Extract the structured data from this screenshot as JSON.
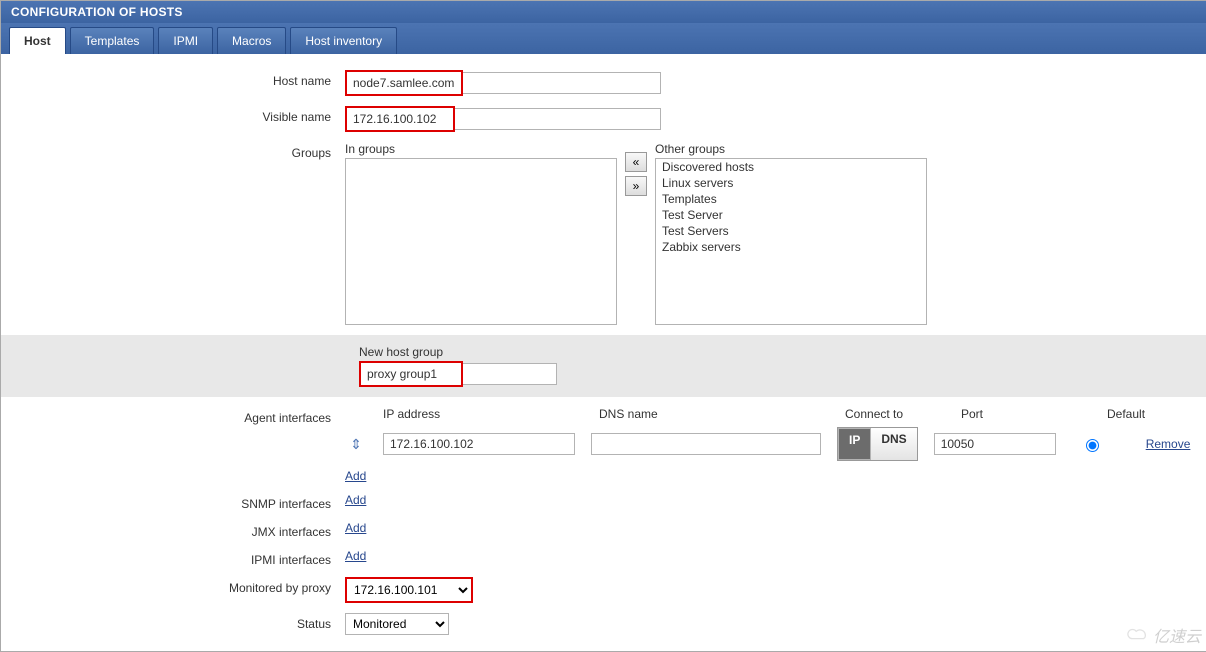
{
  "header": {
    "title": "CONFIGURATION OF HOSTS"
  },
  "tabs": [
    "Host",
    "Templates",
    "IPMI",
    "Macros",
    "Host inventory"
  ],
  "active_tab": "Host",
  "labels": {
    "host_name": "Host name",
    "visible_name": "Visible name",
    "groups": "Groups",
    "in_groups": "In groups",
    "other_groups": "Other groups",
    "new_host_group": "New host group",
    "agent_interfaces": "Agent interfaces",
    "snmp_interfaces": "SNMP interfaces",
    "jmx_interfaces": "JMX interfaces",
    "ipmi_interfaces": "IPMI interfaces",
    "monitored_by_proxy": "Monitored by proxy",
    "status": "Status",
    "ip_address": "IP address",
    "dns_name": "DNS name",
    "connect_to": "Connect to",
    "port": "Port",
    "default": "Default",
    "add": "Add",
    "remove": "Remove",
    "ip_btn": "IP",
    "dns_btn": "DNS"
  },
  "values": {
    "host_name": "node7.samlee.com",
    "visible_name": "172.16.100.102",
    "new_host_group": "proxy group1",
    "agent_ip": "172.16.100.102",
    "agent_dns": "",
    "agent_port": "10050",
    "proxy": "172.16.100.101",
    "status": "Monitored"
  },
  "other_groups": [
    "Discovered hosts",
    "Linux servers",
    "Templates",
    "Test Server",
    "Test Servers",
    "Zabbix servers"
  ],
  "watermark": "亿速云"
}
